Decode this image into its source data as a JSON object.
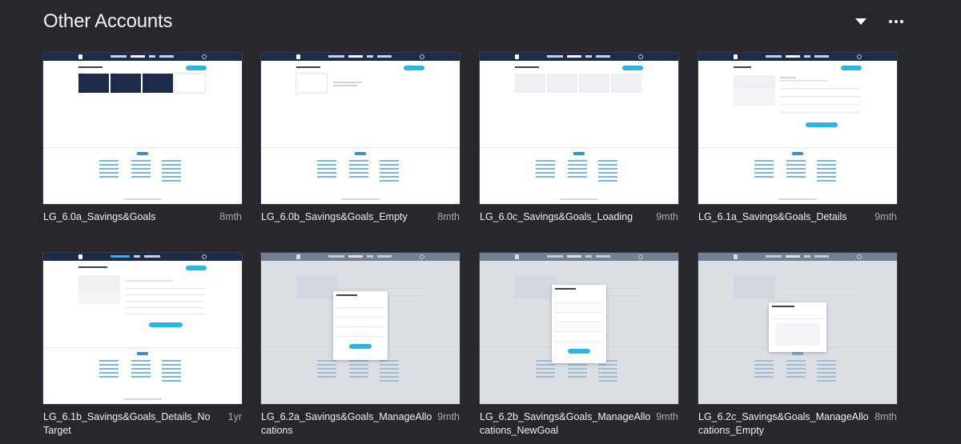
{
  "header": {
    "title": "Other Accounts",
    "dropdown_icon": "caret-down-icon",
    "more_icon": "more-horizontal-icon"
  },
  "files": [
    {
      "name": "LG_6.0a_Savings&Goals",
      "age": "8mth"
    },
    {
      "name": "LG_6.0b_Savings&Goals_Empty",
      "age": "8mth"
    },
    {
      "name": "LG_6.0c_Savings&Goals_Loading",
      "age": "9mth"
    },
    {
      "name": "LG_6.1a_Savings&Goals_Details",
      "age": "9mth"
    },
    {
      "name": "LG_6.1b_Savings&Goals_Details_NoTarget",
      "age": "1yr"
    },
    {
      "name": "LG_6.2a_Savings&Goals_ManageAllocations",
      "age": "9mth"
    },
    {
      "name": "LG_6.2b_Savings&Goals_ManageAllocations_NewGoal",
      "age": "9mth"
    },
    {
      "name": "LG_6.2c_Savings&Goals_ManageAllocations_Empty",
      "age": "8mth"
    }
  ],
  "colors": {
    "background": "#26282d",
    "nav": "#1c2a4b",
    "accent": "#29b6e6"
  }
}
